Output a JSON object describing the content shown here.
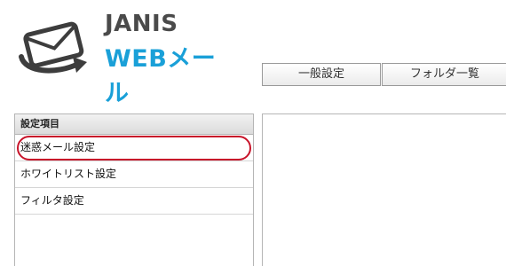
{
  "logo": {
    "name_top": "JANIS",
    "name_bottom": "WEBメール",
    "colors": {
      "text_dark": "#4a4a4a",
      "accent": "#1aa0d8",
      "icon": "#3d3d3d"
    },
    "icon": "envelope-arrow-icon"
  },
  "tabs": [
    {
      "label": "一般設定"
    },
    {
      "label": "フォルダ一覧"
    }
  ],
  "sidebar": {
    "header": "設定項目",
    "items": [
      {
        "label": "迷惑メール設定",
        "selected": true
      },
      {
        "label": "ホワイトリスト設定",
        "selected": false
      },
      {
        "label": "フィルタ設定",
        "selected": false
      }
    ],
    "highlight_color": "#c8142a"
  }
}
